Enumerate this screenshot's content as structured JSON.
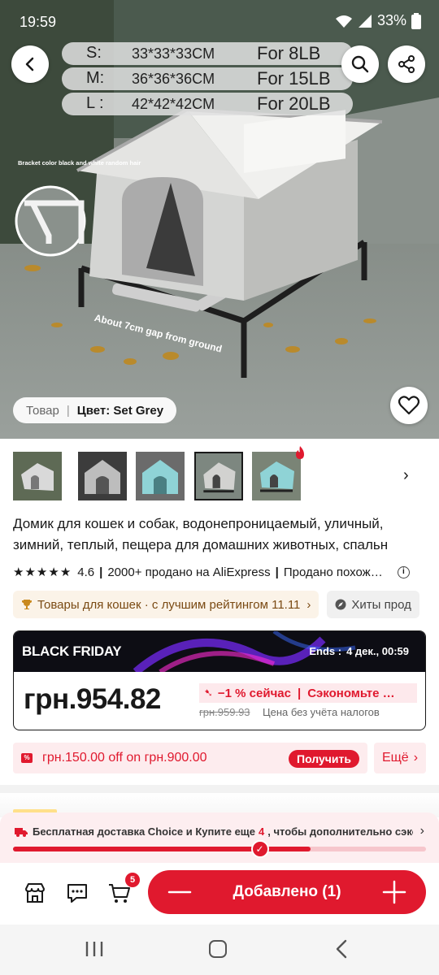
{
  "status_bar": {
    "time": "19:59",
    "battery": "33%"
  },
  "hero": {
    "sizes": [
      {
        "name": "S:",
        "dimensions": "33*33*33CM",
        "fits": "For 8LB"
      },
      {
        "name": "M:",
        "dimensions": "36*36*36CM",
        "fits": "For 15LB"
      },
      {
        "name": "L :",
        "dimensions": "42*42*42CM",
        "fits": "For 20LB"
      }
    ],
    "bracket_note": "Bracket color black and white random hair",
    "gap_note": "About 7cm gap from ground",
    "variant_label": "Товар",
    "variant_value": "Цвет: Set Grey"
  },
  "thumbnails": [
    {
      "color": "grey",
      "selected": false
    },
    {
      "color": "dark-grey",
      "selected": false
    },
    {
      "color": "blue",
      "selected": false
    },
    {
      "color": "grey",
      "selected": true
    },
    {
      "color": "teal",
      "selected": false
    }
  ],
  "product": {
    "title": "Домик для кошек и собак, водонепроницаемый, уличный, зимний, теплый, пещера для домашних животных, спальн",
    "rating": "4.6",
    "sold": "2000+ продано на AliExpress",
    "sold_more": "Продано похож…"
  },
  "chips": [
    "Товары для кошек · с лучшим рейтингом 11.11",
    "Хиты прод"
  ],
  "price_card": {
    "banner": "BLACK FRIDAY",
    "ends_label": "Ends :",
    "ends_date": "4 дек., 00:59",
    "price": "грн.954.82",
    "discount": "−1 % сейчас",
    "save": "Сэкономьте …",
    "old_price": "грн.959.93",
    "tax_note": "Цена без учёта налогов"
  },
  "coupon": {
    "text": "грн.150.00 off on грн.900.00",
    "button": "Получить",
    "more": "Ещё"
  },
  "shipping": {
    "prefix": "Бесплатная доставка Choice и Купите еще",
    "count": "4",
    "suffix": ", чтобы дополнительно сэконо…",
    "progress": 0.72
  },
  "action_bar": {
    "cart_count": "5",
    "added_label": "Добавлено (1)"
  },
  "colors": {
    "accent": "#e0192e",
    "text": "#191919",
    "chip_bg": "#fbf3e8"
  }
}
